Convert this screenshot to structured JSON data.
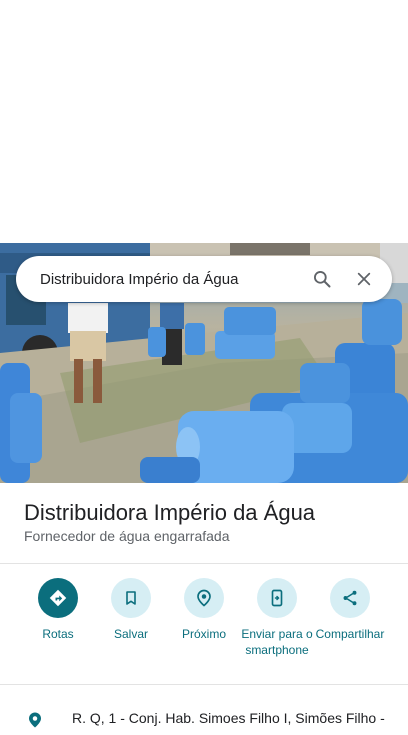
{
  "search": {
    "query": "Distribuidora Império da Água"
  },
  "place": {
    "title": "Distribuidora Império da Água",
    "category": "Fornecedor de água engarrafada"
  },
  "actions": [
    {
      "label": "Rotas",
      "icon": "directions-icon"
    },
    {
      "label": "Salvar",
      "icon": "bookmark-icon"
    },
    {
      "label": "Próximo",
      "icon": "nearby-icon"
    },
    {
      "label": "Enviar para o smartphone",
      "icon": "send-to-phone-icon"
    },
    {
      "label": "Compartilhar",
      "icon": "share-icon"
    }
  ],
  "address": {
    "text": "R. Q, 1 - Conj. Hab. Simoes Filho I, Simões Filho -"
  },
  "colors": {
    "accent": "#0b6e7d",
    "action_bg": "#d6eef4"
  }
}
